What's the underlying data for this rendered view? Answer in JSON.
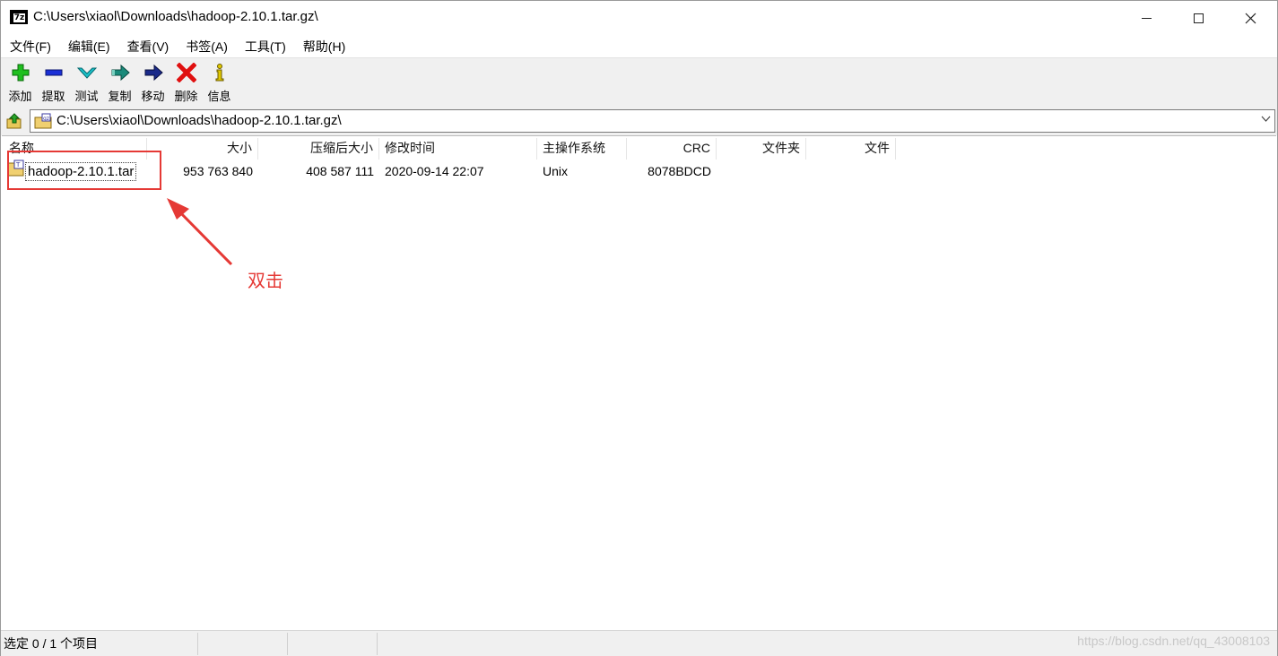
{
  "window": {
    "title": "C:\\Users\\xiaol\\Downloads\\hadoop-2.10.1.tar.gz\\",
    "app_icon_text": "7z",
    "controls": {
      "minimize": "—",
      "maximize": "☐",
      "close": "✕"
    }
  },
  "menu": {
    "items": [
      {
        "label": "文件(F)"
      },
      {
        "label": "编辑(E)"
      },
      {
        "label": "查看(V)"
      },
      {
        "label": "书签(A)"
      },
      {
        "label": "工具(T)"
      },
      {
        "label": "帮助(H)"
      }
    ]
  },
  "toolbar": {
    "buttons": [
      {
        "label": "添加",
        "icon": "add-icon",
        "color": "#1fbf1f"
      },
      {
        "label": "提取",
        "icon": "extract-icon",
        "color": "#1a2fd6"
      },
      {
        "label": "测试",
        "icon": "test-icon",
        "color": "#19c0c8"
      },
      {
        "label": "复制",
        "icon": "copy-icon",
        "color": "#1a8a7a"
      },
      {
        "label": "移动",
        "icon": "move-icon",
        "color": "#1a2a8a"
      },
      {
        "label": "删除",
        "icon": "delete-icon",
        "color": "#e01010"
      },
      {
        "label": "信息",
        "icon": "info-icon",
        "color": "#e0c800"
      }
    ]
  },
  "address": {
    "path": "C:\\Users\\xiaol\\Downloads\\hadoop-2.10.1.tar.gz\\"
  },
  "columns": {
    "name": "名称",
    "size": "大小",
    "packed_size": "压缩后大小",
    "modified": "修改时间",
    "host_os": "主操作系统",
    "crc": "CRC",
    "folders": "文件夹",
    "files": "文件"
  },
  "rows": [
    {
      "name": "hadoop-2.10.1.tar",
      "size": "953 763 840",
      "packed_size": "408 587 111",
      "modified": "2020-09-14 22:07",
      "host_os": "Unix",
      "crc": "8078BDCD",
      "folders": "",
      "files": ""
    }
  ],
  "annotation": {
    "text": "双击",
    "color": "#e53935"
  },
  "status": {
    "selection": "选定 0 / 1 个项目",
    "pane2": "",
    "pane3": "",
    "watermark": "https://blog.csdn.net/qq_43008103"
  }
}
